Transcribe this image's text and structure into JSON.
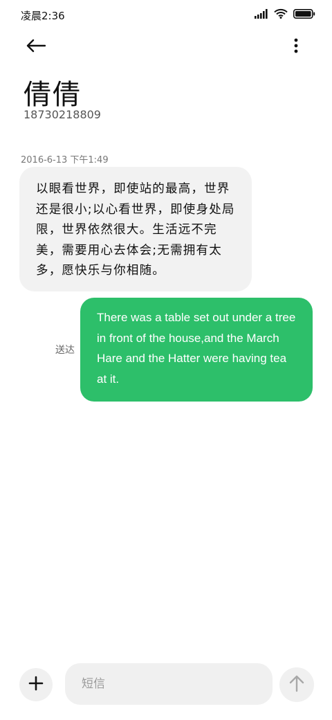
{
  "status_bar": {
    "time": "凌晨2:36"
  },
  "contact": {
    "name": "倩倩",
    "number": "18730218809"
  },
  "thread": {
    "timestamp": "2016-6-13 下午1:49",
    "incoming_message": "以眼看世界，即使站的最高，世界还是很小;以心看世界，即使身处局限，世界依然很大。生活远不完美，需要用心去体会;无需拥有太多，愿快乐与你相随。",
    "outgoing_message": "There was a table set out under a tree in front of the house,and the March Hare and the Hatter were having tea at it.",
    "delivery_status": "送达"
  },
  "composer": {
    "placeholder": "短信"
  },
  "colors": {
    "outgoing_bubble": "#2dbf6a",
    "incoming_bubble": "#f2f2f2"
  },
  "icons": {
    "back": "back-arrow-icon",
    "more": "more-vertical-icon",
    "add": "plus-icon",
    "send": "send-arrow-up-icon",
    "signal": "signal-icon",
    "wifi": "wifi-icon",
    "battery": "battery-icon"
  }
}
